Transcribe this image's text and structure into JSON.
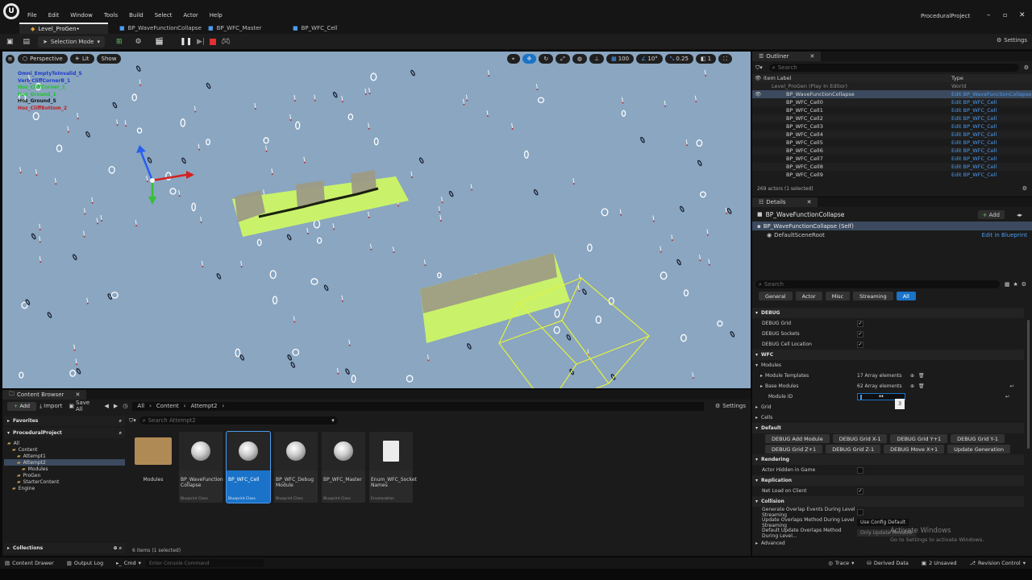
{
  "app": {
    "project_name": "ProceduralProject",
    "menu": [
      "File",
      "Edit",
      "Window",
      "Tools",
      "Build",
      "Select",
      "Actor",
      "Help"
    ]
  },
  "tabs": [
    {
      "label": "Level_ProGen•"
    },
    {
      "label": "BP_WaveFunctionCollapse"
    },
    {
      "label": "BP_WFC_Master"
    },
    {
      "label": "BP_WFC_Cell"
    }
  ],
  "toolbar": {
    "selection_mode": "Selection Mode",
    "settings": "Settings"
  },
  "viewport": {
    "perspective": "Perspective",
    "lit": "Lit",
    "show": "Show",
    "grid_size": "100",
    "angle": "10°",
    "scale": "0.25",
    "camera_speed": "1",
    "debug_labels": [
      {
        "text": "Omni_EmptyToInvalid_S",
        "color": "#1e3cc8"
      },
      {
        "text": "Vert_CliffCornerB_1",
        "color": "#1e3cc8"
      },
      {
        "text": "Hoz_CliffCorner_1",
        "color": "#22c033"
      },
      {
        "text": "Hoz_Ground_1",
        "color": "#22c033"
      },
      {
        "text": "Hoz_Ground_S",
        "color": "#111111"
      },
      {
        "text": "Hoz_CliffBottom_2",
        "color": "#c01e1e"
      }
    ]
  },
  "outliner": {
    "title": "Outliner",
    "search_placeholder": "Search",
    "col_label": "Item Label",
    "col_type": "Type",
    "rows": [
      {
        "label": "Level_ProGen (Play In Editor)",
        "type": "World"
      },
      {
        "label": "BP_WaveFunctionCollapse",
        "type": "Edit BP_WaveFunctionCollapse"
      },
      {
        "label": "BP_WFC_Cell0",
        "type": "Edit BP_WFC_Cell"
      },
      {
        "label": "BP_WFC_Cell1",
        "type": "Edit BP_WFC_Cell"
      },
      {
        "label": "BP_WFC_Cell2",
        "type": "Edit BP_WFC_Cell"
      },
      {
        "label": "BP_WFC_Cell3",
        "type": "Edit BP_WFC_Cell"
      },
      {
        "label": "BP_WFC_Cell4",
        "type": "Edit BP_WFC_Cell"
      },
      {
        "label": "BP_WFC_Cell5",
        "type": "Edit BP_WFC_Cell"
      },
      {
        "label": "BP_WFC_Cell6",
        "type": "Edit BP_WFC_Cell"
      },
      {
        "label": "BP_WFC_Cell7",
        "type": "Edit BP_WFC_Cell"
      },
      {
        "label": "BP_WFC_Cell8",
        "type": "Edit BP_WFC_Cell"
      },
      {
        "label": "BP_WFC_Cell9",
        "type": "Edit BP_WFC_Cell"
      }
    ],
    "footer": "269 actors (1 selected)"
  },
  "details": {
    "title": "Details",
    "actor_name": "BP_WaveFunctionCollapse",
    "add_label": "Add",
    "self_label": "BP_WaveFunctionCollapse (Self)",
    "root_label": "DefaultSceneRoot",
    "edit_in_blueprint": "Edit in Blueprint",
    "search_placeholder": "Search",
    "filters": [
      "General",
      "Actor",
      "Misc",
      "Streaming",
      "All"
    ],
    "debug_header": "DEBUG",
    "debug_props": [
      "DEBUG Grid",
      "DEBUG Sockets",
      "DEBUG Cell Location"
    ],
    "wfc_header": "WFC",
    "modules_label": "Modules",
    "module_templates": "Module Templates",
    "module_templates_value": "17 Array elements",
    "base_modules": "Base Modules",
    "base_modules_value": "62 Array elements",
    "module_id": "Module ID",
    "module_id_tooltip": "3",
    "grid_label": "Grid",
    "cells_label": "Cells",
    "default_header": "Default",
    "default_buttons_row1": [
      "DEBUG Add Module",
      "DEBUG Grid X-1",
      "DEBUG Grid Y+1",
      "DEBUG Grid Y-1"
    ],
    "default_buttons_row2": [
      "DEBUG Grid Z+1",
      "DEBUG Grid Z-1",
      "DEBUG Move X+1",
      "Update Generation"
    ],
    "rendering_header": "Rendering",
    "actor_hidden": "Actor Hidden in Game",
    "replication_header": "Replication",
    "net_load": "Net Load on Client",
    "collision_header": "Collision",
    "gen_overlap": "Generate Overlap Events During Level Streaming",
    "update_overlap": "Update Overlaps Method During Level Streaming",
    "update_overlap_value": "Use Config Default",
    "default_update_overlap": "Default Update Overlaps Method During Level...",
    "default_update_overlap_value": "Only Update Movable",
    "advanced": "Advanced"
  },
  "content_browser": {
    "title": "Content Browser",
    "add": "Add",
    "import": "Import",
    "save_all": "Save All",
    "settings": "Settings",
    "path": [
      "All",
      "Content",
      "Attempt2"
    ],
    "favorites": "Favorites",
    "project": "ProceduralProject",
    "search_placeholder": "Search Attempt2",
    "tree": [
      {
        "label": "All",
        "depth": 0
      },
      {
        "label": "Content",
        "depth": 1
      },
      {
        "label": "Attempt1",
        "depth": 2
      },
      {
        "label": "Attempt2",
        "depth": 2
      },
      {
        "label": "Modules",
        "depth": 3
      },
      {
        "label": "ProGen",
        "depth": 2
      },
      {
        "label": "StarterContent",
        "depth": 2
      },
      {
        "label": "Engine",
        "depth": 1
      }
    ],
    "assets": [
      {
        "name": "Modules",
        "kind": ""
      },
      {
        "name": "BP_WaveFunction Collapse",
        "kind": "Blueprint Class"
      },
      {
        "name": "BP_WFC_Cell",
        "kind": "Blueprint Class"
      },
      {
        "name": "BP_WFC_Debug Module",
        "kind": "Blueprint Class"
      },
      {
        "name": "BP_WFC_Master",
        "kind": "Blueprint Class"
      },
      {
        "name": "Enum_WFC_Socket Names",
        "kind": "Enumeration"
      }
    ],
    "collections": "Collections",
    "item_count": "6 items (1 selected)"
  },
  "statusbar": {
    "content_drawer": "Content Drawer",
    "output_log": "Output Log",
    "cmd": "Cmd",
    "console_placeholder": "Enter Console Command",
    "trace": "Trace",
    "derived_data": "Derived Data",
    "unsaved": "2 Unsaved",
    "revision_control": "Revision Control"
  },
  "watermark": {
    "line1": "Activate Windows",
    "line2": "Go to Settings to activate Windows."
  }
}
